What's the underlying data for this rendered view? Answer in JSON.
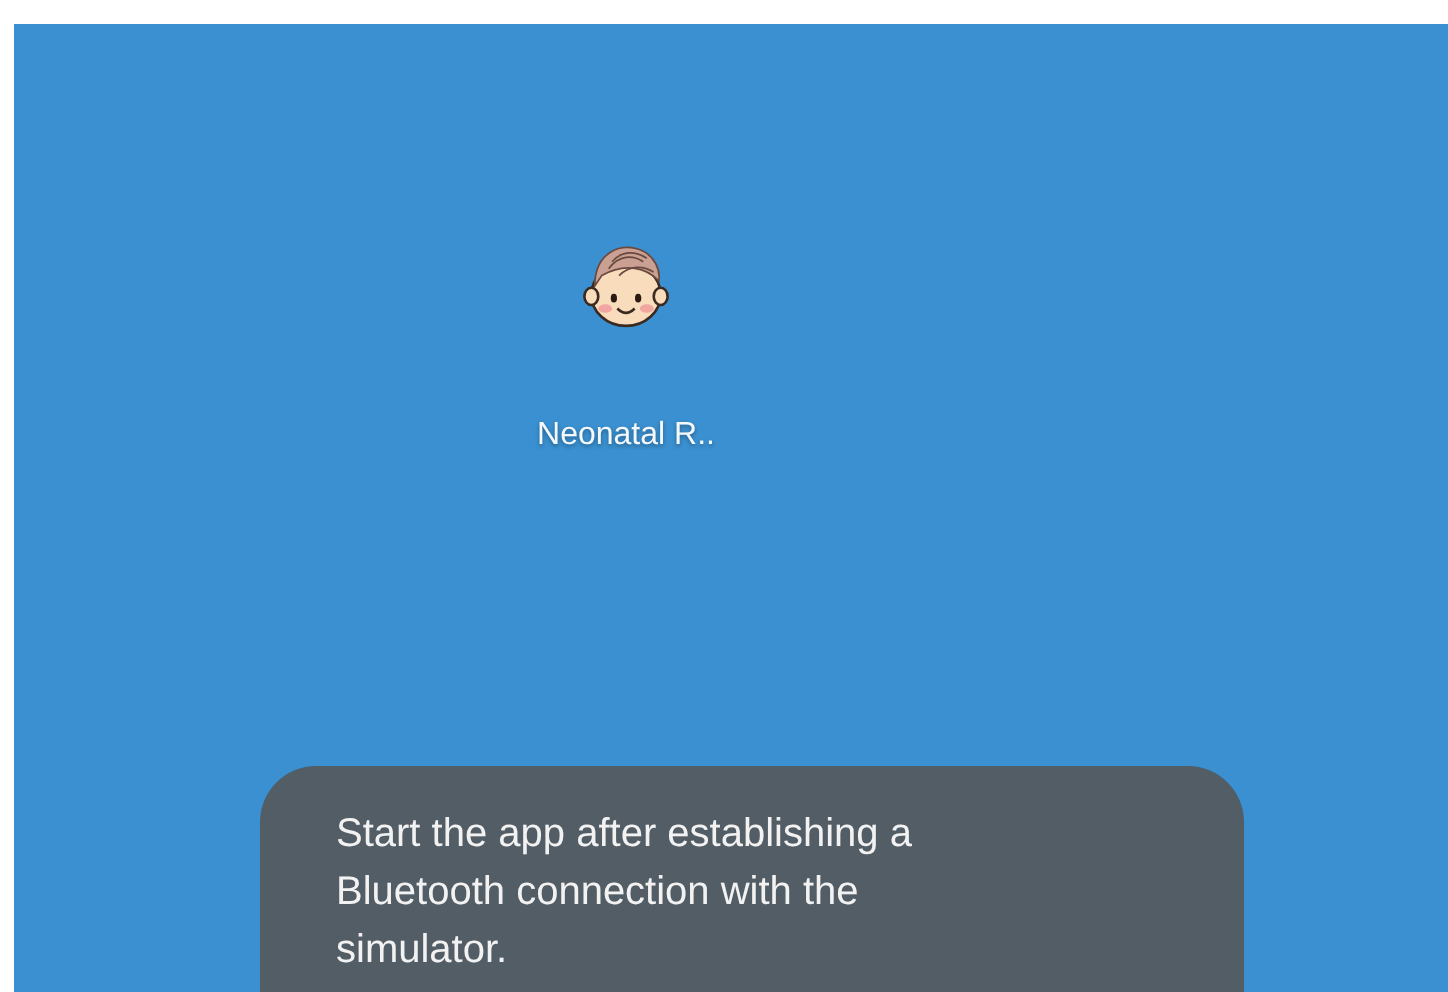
{
  "home_screen": {
    "apps": [
      {
        "label": "Neonatal R.."
      }
    ]
  },
  "toast": {
    "message": "Start the app after establishing a Bluetooth connection with the simulator."
  }
}
